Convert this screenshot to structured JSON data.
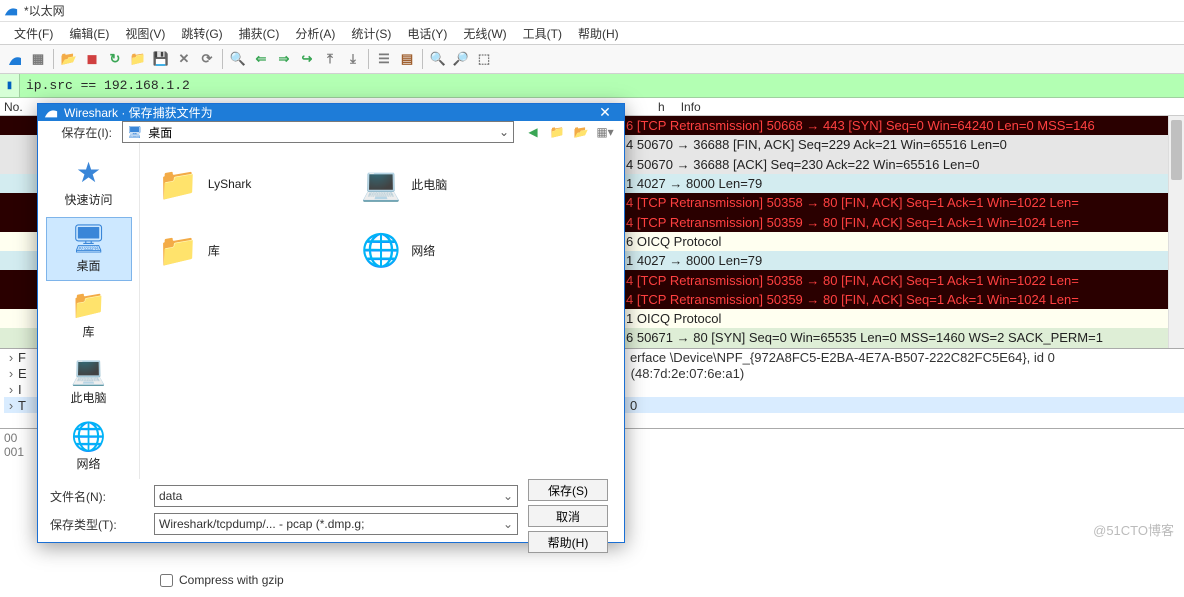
{
  "window": {
    "title": "*以太网"
  },
  "menus": [
    "文件(F)",
    "编辑(E)",
    "视图(V)",
    "跳转(G)",
    "捕获(C)",
    "分析(A)",
    "统计(S)",
    "电话(Y)",
    "无线(W)",
    "工具(T)",
    "帮助(H)"
  ],
  "filter": {
    "value": "ip.src == 192.168.1.2"
  },
  "list_header": {
    "no": "No.",
    "h": "h",
    "info": "Info"
  },
  "rows": [
    {
      "cls": "bg-black-red",
      "text": "6 [TCP Retransmission] 50668 → 443 [SYN] Seq=0 Win=64240 Len=0 MSS=146"
    },
    {
      "cls": "bg-gray",
      "text": "4 50670 → 36688 [FIN, ACK] Seq=229 Ack=21 Win=65516 Len=0"
    },
    {
      "cls": "bg-gray",
      "text": "4 50670 → 36688 [ACK] Seq=230 Ack=22 Win=65516 Len=0"
    },
    {
      "cls": "bg-cyan",
      "text": "1 4027 → 8000 Len=79"
    },
    {
      "cls": "bg-black-red",
      "text": "4 [TCP Retransmission] 50358 → 80 [FIN, ACK] Seq=1 Ack=1 Win=1022 Len="
    },
    {
      "cls": "bg-black-red",
      "text": "4 [TCP Retransmission] 50359 → 80 [FIN, ACK] Seq=1 Ack=1 Win=1024 Len="
    },
    {
      "cls": "bg-ltyellow",
      "text": "6 OICQ Protocol"
    },
    {
      "cls": "bg-cyan",
      "text": "1 4027 → 8000 Len=79"
    },
    {
      "cls": "bg-black-red",
      "text": "4 [TCP Retransmission] 50358 → 80 [FIN, ACK] Seq=1 Ack=1 Win=1022 Len="
    },
    {
      "cls": "bg-black-red",
      "text": "4 [TCP Retransmission] 50359 → 80 [FIN, ACK] Seq=1 Ack=1 Win=1024 Len="
    },
    {
      "cls": "bg-ltyellow",
      "text": "1 OICQ Protocol"
    },
    {
      "cls": "bg-green",
      "text": "6 50671 → 80 [SYN] Seq=0 Win=65535 Len=0 MSS=1460 WS=2 SACK_PERM=1"
    }
  ],
  "tree": {
    "frame_tail": "erface \\Device\\NPF_{972A8FC5-E2BA-4E7A-B507-222C82FC5E64}, id 0",
    "eth_tail": " (48:7d:2e:07:6e:a1)",
    "ip_tail": "",
    "tcp_tail": "0",
    "left": [
      "F",
      "E",
      "I",
      "T"
    ]
  },
  "hex": {
    "l1": "00",
    "l2": "001"
  },
  "dialog": {
    "title": "Wireshark · 保存捕获文件为",
    "save_in_label": "保存在(I):",
    "save_in_value": "桌面",
    "sidebar": [
      {
        "name": "quick",
        "label": "快速访问",
        "glyph": "★",
        "cls": "c-blue",
        "selected": false
      },
      {
        "name": "desktop",
        "label": "桌面",
        "glyph": "🖥",
        "cls": "c-blue",
        "selected": true
      },
      {
        "name": "libs",
        "label": "库",
        "glyph": "📁",
        "cls": "c-orange",
        "selected": false
      },
      {
        "name": "thispc",
        "label": "此电脑",
        "glyph": "💻",
        "cls": "c-blue",
        "selected": false
      },
      {
        "name": "network",
        "label": "网络",
        "glyph": "🌐",
        "cls": "c-blue",
        "selected": false
      }
    ],
    "files_left": [
      {
        "name": "lyshark",
        "label": "LyShark",
        "glyph": "📁",
        "cls": "c-orange"
      },
      {
        "name": "libs2",
        "label": "库",
        "glyph": "📁",
        "cls": "c-orange"
      }
    ],
    "files_right": [
      {
        "name": "thispc2",
        "label": "此电脑",
        "glyph": "💻",
        "cls": "c-blue"
      },
      {
        "name": "network2",
        "label": "网络",
        "glyph": "🌐",
        "cls": "c-blue"
      }
    ],
    "filename_label": "文件名(N):",
    "filename_value": "data",
    "type_label": "保存类型(T):",
    "type_value": "Wireshark/tcpdump/... - pcap (*.dmp.g;",
    "save_btn": "保存(S)",
    "cancel_btn": "取消",
    "help_btn": "帮助(H)",
    "compress_label": "Compress with gzip"
  },
  "watermark": "@51CTO博客"
}
